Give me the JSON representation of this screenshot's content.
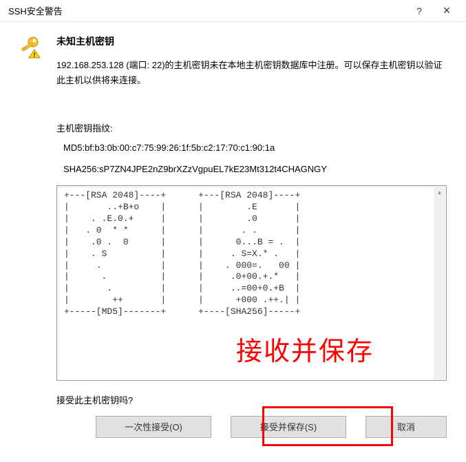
{
  "titlebar": {
    "title": "SSH安全警告",
    "help": "?",
    "close": "×"
  },
  "dialog": {
    "heading": "未知主机密钥",
    "description": "192.168.253.128 (端口: 22)的主机密钥未在本地主机密钥数据库中注册。可以保存主机密钥以验证此主机以供将来连接。",
    "fingerprint_label": "主机密钥指纹:",
    "md5": "MD5:bf:b3:0b:00:c7:75:99:26:1f:5b:c2:17:70:c1:90:1a",
    "sha256": "SHA256:sP7ZN4JPE2nZ9brXZzVgpuEL7kE23Mt312t4CHAGNGY",
    "ascii_art": "+---[RSA 2048]----+      +---[RSA 2048]----+\n|       ..+B+o    |      |        .E       |\n|    . .E.0.+     |      |        .0       |\n|   . 0  * *      |      |       . .       |\n|    .0 .  0      |      |      0...B = .  |\n|    . S          |      |     . S=X.* .   |\n|     .           |      |    . 000=.   00 |\n|      .          |      |     .0+00.+.*   |\n|       .         |      |     ..=00+0.+B  |\n|        ++       |      |      +000 .++.| |\n+-----[MD5]-------+      +----[SHA256]-----+",
    "prompt": "接受此主机密钥吗?",
    "annotation": "接收并保存"
  },
  "buttons": {
    "accept_once": "一次性接受(O)",
    "accept_save": "接受并保存(S)",
    "cancel": "取消"
  }
}
